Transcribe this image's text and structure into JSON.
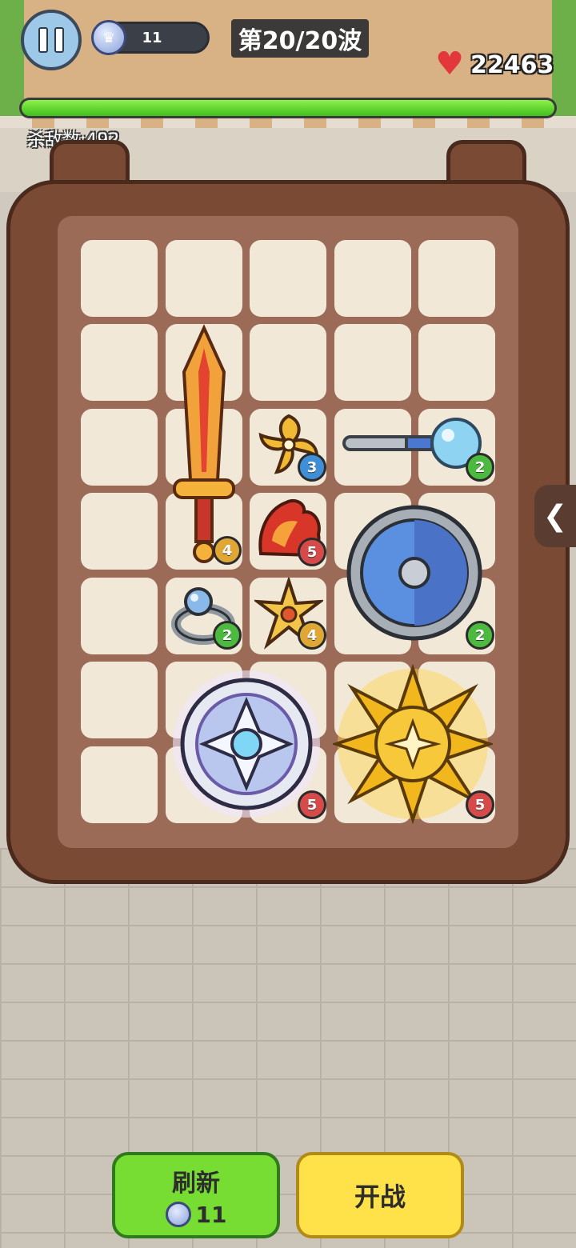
{
  "hud": {
    "pause_icon": "pause-icon",
    "coin_count": "11",
    "wave_text": "第20/20波",
    "hp": "22463",
    "hp_fill_fraction": 1.0,
    "kills_text": "杀敌数:492"
  },
  "backpack": {
    "items": [
      {
        "name": "sword",
        "level": "4",
        "badge_color": "#e1a735"
      },
      {
        "name": "shuriken-gold",
        "level": "3",
        "badge_color": "#3f8fd8"
      },
      {
        "name": "magic-staff",
        "level": "2",
        "badge_color": "#4cba3f"
      },
      {
        "name": "flame-helmet",
        "level": "5",
        "badge_color": "#d64a4a"
      },
      {
        "name": "round-shield",
        "level": "2",
        "badge_color": "#4cba3f"
      },
      {
        "name": "ring",
        "level": "2",
        "badge_color": "#4cba3f"
      },
      {
        "name": "star-shuriken",
        "level": "4",
        "badge_color": "#e1a735"
      },
      {
        "name": "crystal-disc",
        "level": "5",
        "badge_color": "#d64a4a"
      },
      {
        "name": "golden-emblem",
        "level": "5",
        "badge_color": "#d64a4a"
      }
    ],
    "side_tab_icon": "chevron-left-icon"
  },
  "buttons": {
    "refresh_label": "刷新",
    "refresh_cost": "11",
    "battle_label": "开战"
  }
}
